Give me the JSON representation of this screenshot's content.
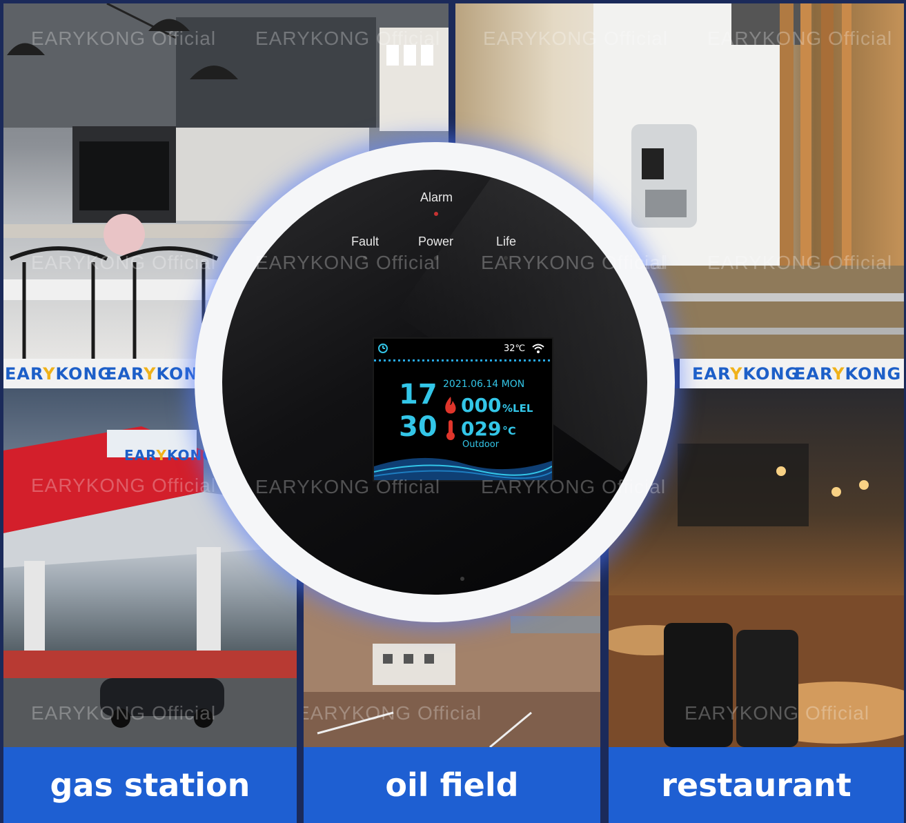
{
  "watermark_text": "EARYKONG Official",
  "logo": {
    "prefix": "EAR",
    "mark": "Y",
    "suffix": "KONG"
  },
  "detector": {
    "led_labels": {
      "alarm": "Alarm",
      "fault": "Fault",
      "power": "Power",
      "life": "Life"
    },
    "screen": {
      "temp_top": "32℃",
      "time_hour": "17",
      "time_minute": "30",
      "date": "2021.06.14 MON",
      "gas_value": "000",
      "gas_unit": "%LEL",
      "temp_value": "029",
      "temp_unit": "°C",
      "temp_location": "Outdoor"
    }
  },
  "scenes": {
    "gas_station": {
      "label": "gas station"
    },
    "oil_field": {
      "label": "oil field"
    },
    "restaurant": {
      "label": "restaurant"
    }
  },
  "colors": {
    "label_bar": "#1e5fd2",
    "screen_cyan": "#33c6e8",
    "flame_red": "#e0352b",
    "led_red": "#c73232"
  }
}
